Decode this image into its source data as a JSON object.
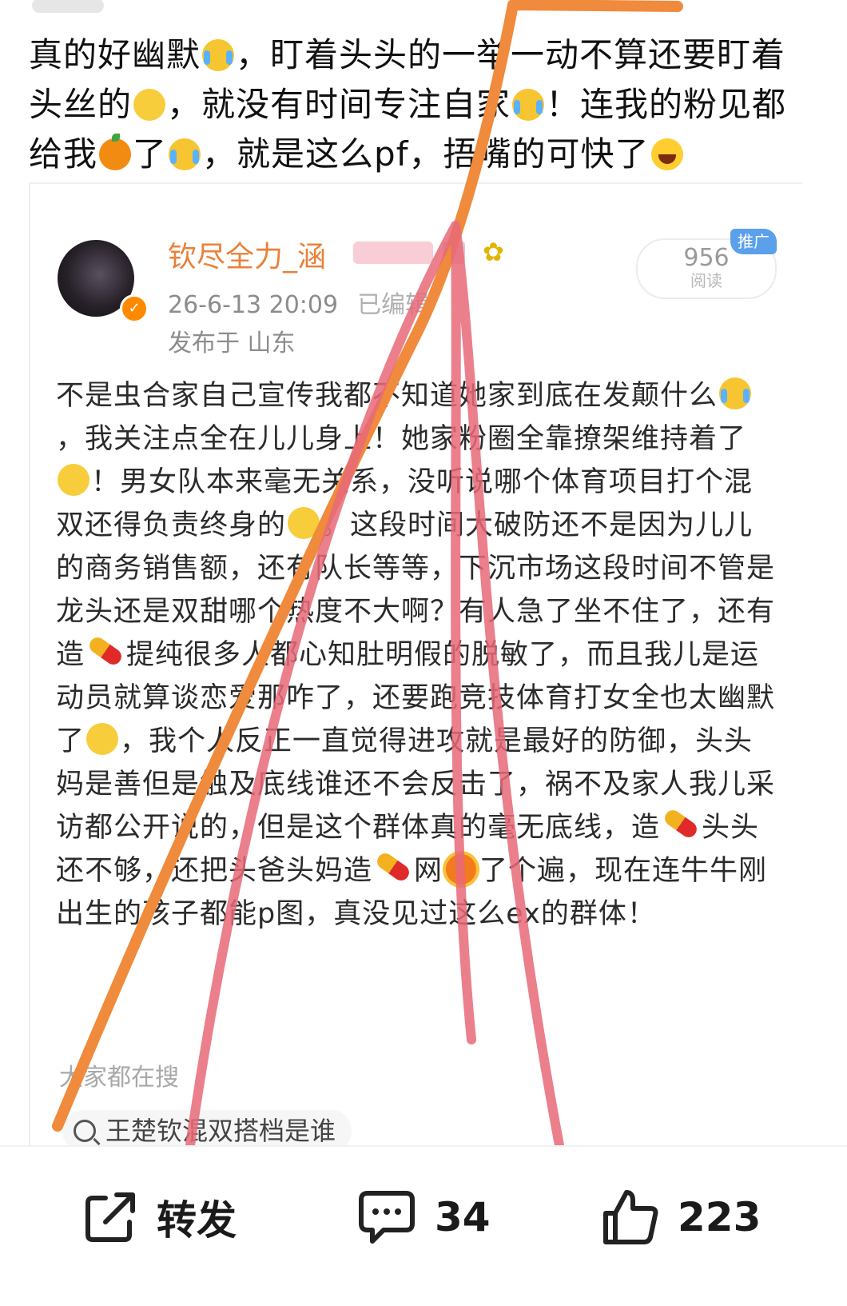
{
  "post": {
    "line1": "真的好幽默",
    "line1b": "，盯着头头的一举一动不算还要盯着",
    "line2": "头丝的",
    "line2b": "，就没有时间专注自家",
    "line2c": "！连我的粉见都",
    "line3": "给我",
    "line3b": "了",
    "line3c": "，就是这么pf，捂嘴",
    "line3d": "的可快了"
  },
  "card": {
    "username": "钦尽全力_涵",
    "timestamp": "26-6-13 20:09",
    "edited_label": "已编辑",
    "location": "发布于 山东",
    "reads_count": "956",
    "reads_label": "阅读",
    "promo_badge": "推广",
    "body": {
      "p1": "不是虫合家自己宣传我都不知道她家到底在发颠什么",
      "p2": "，我关注点全在儿儿身上！她家粉圈全靠撩架维持着了",
      "p3": "！男女队本来毫无关系，没听说哪个体育项目打个混双还得负责终身的",
      "p4": "。这段时间大破防还不是因为儿儿的商务销售额，还有队长等等，下沉市场这段时间不管是龙头还是双甜哪个热度不大啊？有人急了坐不住了，还有造",
      "p5": "提纯很多人都心知肚明假的脱敏了，而且我儿是运动员就算谈恋爱那咋了，还要跑竞技体育打女全也太幽默了",
      "p6": "，我个人反正一直觉得进攻就是最好的防御，头头妈是善但是触及底线谁还不会反击了，祸不及家人我儿采访都公开说的，但是这个群体真的毫无底线，造",
      "p7": "头头还不够，还把头爸头妈造",
      "p8": "网",
      "p9": "了个遍，现在连牛牛刚出生的孩子都能p图，真没见过这么ex的群体！"
    },
    "search_header": "大家都在搜",
    "search_query": "王楚钦混双搭档是谁"
  },
  "actions": {
    "share_label": "转发",
    "comment_count": "34",
    "like_count": "223"
  },
  "icons": {
    "share": "share-icon",
    "comment": "comment-icon",
    "like": "thumbs-up-icon",
    "search": "search-icon"
  },
  "colors": {
    "username": "#e8823a",
    "orange_scribble": "#f08a3c",
    "pink_scribble": "#e86878",
    "promo": "#5aa0ea"
  }
}
